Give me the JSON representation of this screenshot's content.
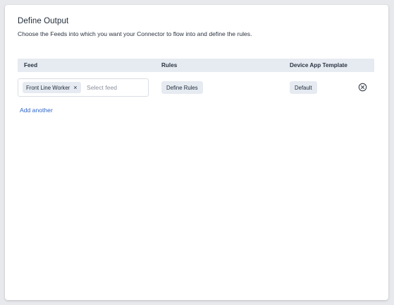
{
  "panel": {
    "title": "Define Output",
    "description": "Choose the Feeds into which you want your Connector to flow into and define the rules."
  },
  "table": {
    "headers": {
      "feed": "Feed",
      "rules": "Rules",
      "template": "Device App Template"
    },
    "rows": [
      {
        "feed_chip": "Front Line Worker",
        "feed_remove_glyph": "×",
        "feed_placeholder": "Select feed",
        "rules_button": "Define Rules",
        "template_button": "Default",
        "remove_icon": "close-circle-icon"
      }
    ]
  },
  "add_another_label": "Add another",
  "colors": {
    "header_bg": "#e6ebf2",
    "link": "#2f64c8",
    "text": "#1f2a37"
  }
}
